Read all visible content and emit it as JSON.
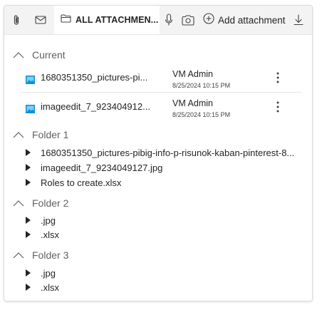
{
  "toolbar": {
    "tab_all_label": "ALL ATTACHMEN...",
    "add_attachment_label": "Add attachment"
  },
  "current": {
    "title": "Current",
    "files": [
      {
        "name": "1680351350_pictures-pi...",
        "author": "VM Admin",
        "date": "8/25/2024 10:15 PM"
      },
      {
        "name": "imageedit_7_923404912...",
        "author": "VM Admin",
        "date": "8/25/2024 10:15 PM"
      }
    ]
  },
  "folders": [
    {
      "title": "Folder 1",
      "items": [
        "1680351350_pictures-pibig-info-p-risunok-kaban-pinterest-8...",
        "imageedit_7_9234049127.jpg",
        "Roles to create.xlsx"
      ]
    },
    {
      "title": "Folder 2",
      "items": [
        ".jpg",
        ".xlsx"
      ]
    },
    {
      "title": "Folder 3",
      "items": [
        ".jpg",
        ".xlsx"
      ]
    }
  ],
  "icons": {
    "attach": "paperclip-icon",
    "mail": "mail-icon",
    "folder": "folder-icon",
    "mic": "microphone-icon",
    "camera": "camera-icon",
    "add": "add-circle-icon",
    "download": "download-icon",
    "file_image": "image-file-icon",
    "more": "more-vertical-icon",
    "collapse": "chevron-up-icon",
    "expand": "caret-right-icon"
  },
  "colors": {
    "accent": "#0f8fd8",
    "text": "#242424",
    "muted": "#616161"
  }
}
